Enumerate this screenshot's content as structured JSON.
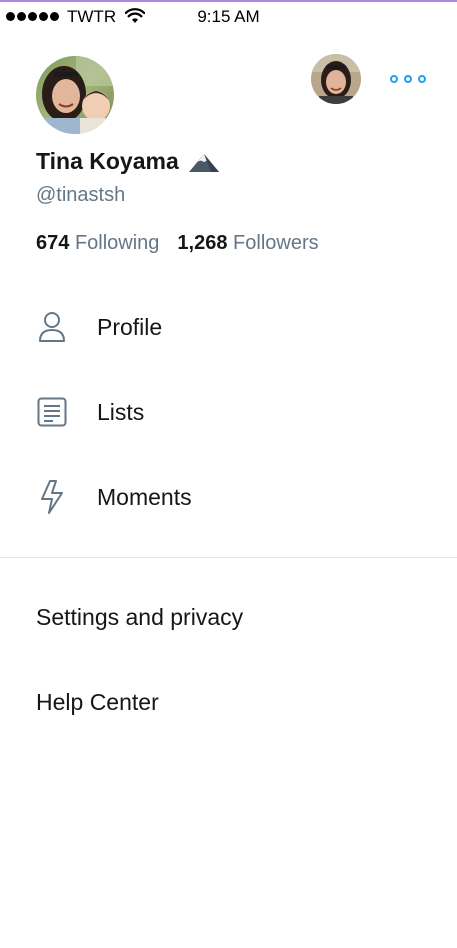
{
  "status_bar": {
    "carrier": "TWTR",
    "time": "9:15 AM"
  },
  "profile": {
    "name": "Tina Koyama",
    "handle": "@tinastsh",
    "following_count": "674",
    "following_label": "Following",
    "followers_count": "1,268",
    "followers_label": "Followers"
  },
  "menu": {
    "items": [
      {
        "label": "Profile",
        "icon": "person-icon"
      },
      {
        "label": "Lists",
        "icon": "lists-icon"
      },
      {
        "label": "Moments",
        "icon": "lightning-icon"
      }
    ]
  },
  "secondary": {
    "settings": "Settings and privacy",
    "help": "Help Center"
  },
  "colors": {
    "accent": "#1da1f2",
    "secondary_text": "#657786",
    "primary_text": "#14171a",
    "divider": "#e1e8ed"
  }
}
